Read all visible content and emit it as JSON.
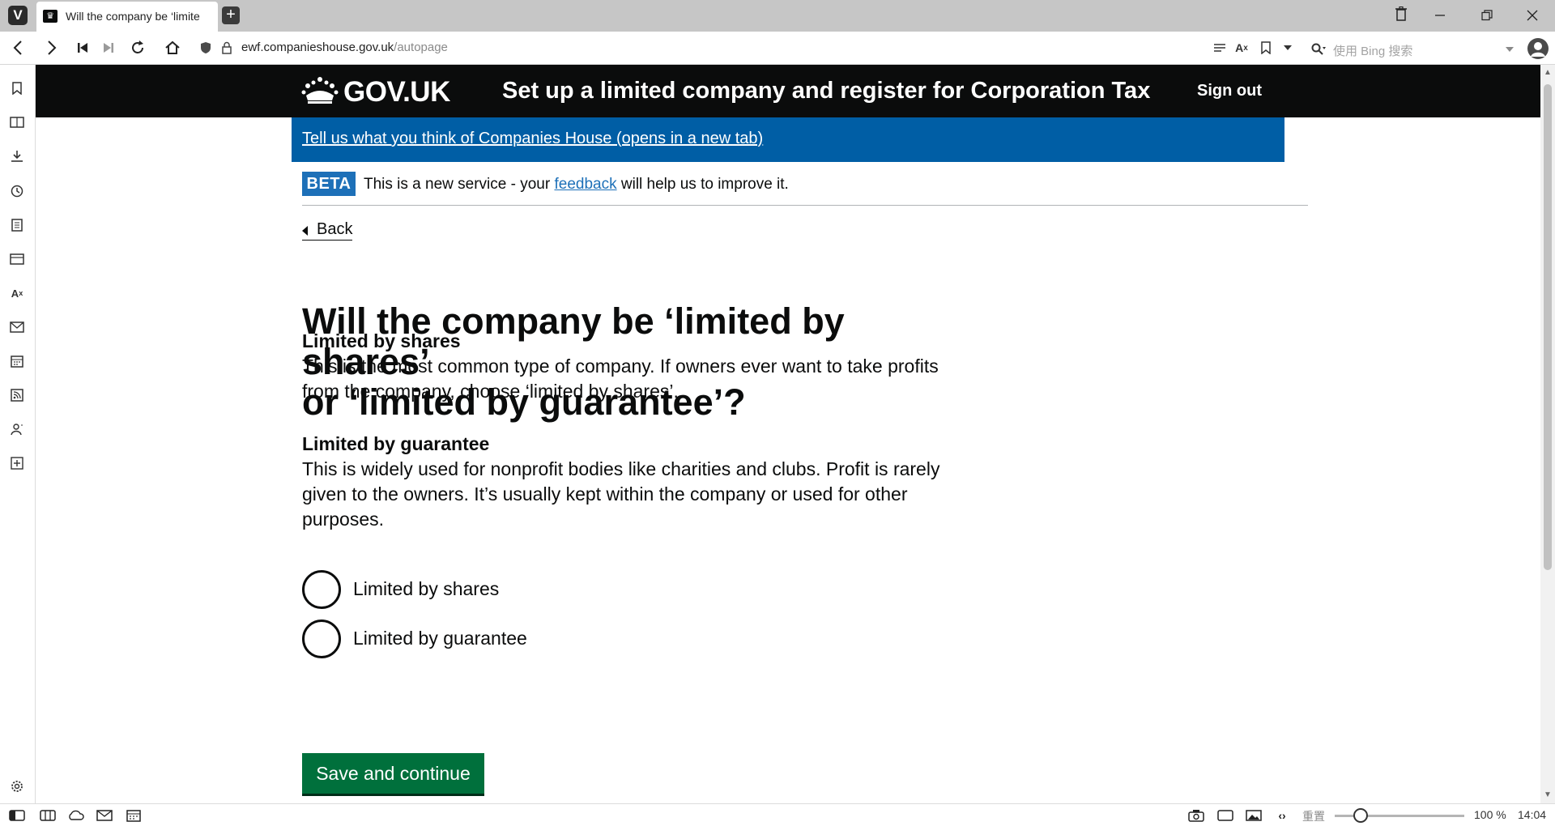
{
  "browser": {
    "tab": {
      "title": "Will the company be ‘limite"
    },
    "address": {
      "domain": "ewf.companieshouse.gov.uk",
      "path": "/autopage"
    },
    "search_placeholder": "使用 Bing 搜索",
    "status": {
      "reset_label": "重置",
      "zoom": "100 %",
      "time": "14:04"
    }
  },
  "header": {
    "logo_text": "GOV.UK",
    "service_name": "Set up a limited company and register for Corporation Tax",
    "sign_out": "Sign out"
  },
  "feedback_banner": {
    "link": "Tell us what you think of Companies House (opens in a new tab)"
  },
  "phase_banner": {
    "tag": "BETA",
    "text_before": "This is a new service - your ",
    "link": "feedback",
    "text_after": " will help us to improve it."
  },
  "back_link": "Back",
  "question": {
    "line1": "Will the company be ‘limited by shares’",
    "line2": "or ‘limited by guarantee’?"
  },
  "sections": [
    {
      "heading": "Limited by shares",
      "lines": [
        "This is the most common type of company. If owners ever want to take profits",
        "from the company, choose ‘limited by shares’."
      ]
    },
    {
      "heading": "Limited by guarantee",
      "lines": [
        "This is widely used for nonprofit bodies like charities and clubs. Profit is rarely",
        "given to the owners. It’s usually kept within the company or used for other",
        "purposes."
      ]
    }
  ],
  "options": [
    "Limited by shares",
    "Limited by guarantee"
  ],
  "submit_label": "Save and continue"
}
